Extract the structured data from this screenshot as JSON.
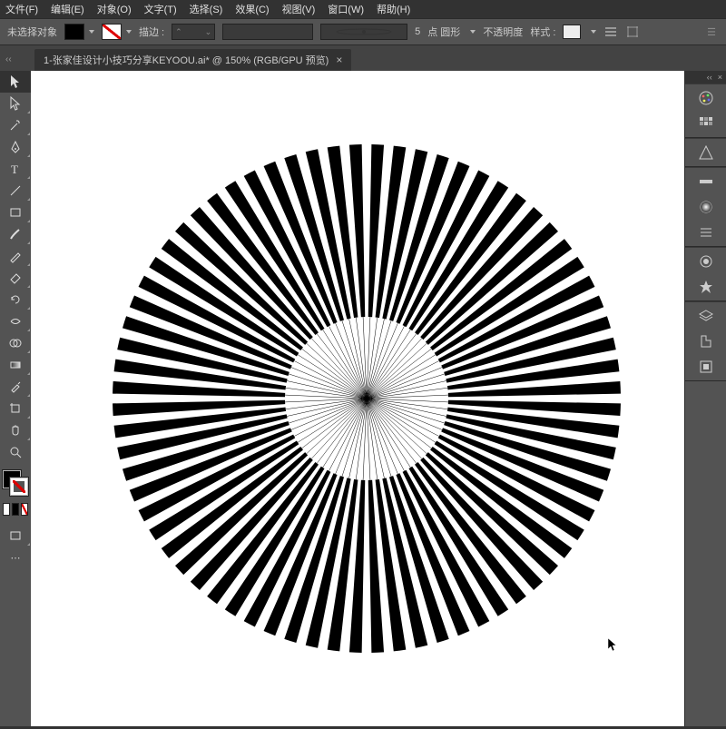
{
  "menu": {
    "items": [
      "文件(F)",
      "编辑(E)",
      "对象(O)",
      "文字(T)",
      "选择(S)",
      "效果(C)",
      "视图(V)",
      "窗口(W)",
      "帮助(H)"
    ]
  },
  "control_bar": {
    "selection_label": "未选择对象",
    "stroke_label": "描边 :",
    "stroke_value": "",
    "point_value": "5",
    "point_label": "点 圆形",
    "opacity_label": "不透明度",
    "style_label": "样式 :"
  },
  "tab": {
    "title": "1-张家佳设计小技巧分享KEYOOU.ai* @ 150% (RGB/GPU 预览)"
  },
  "tools": [
    "selection",
    "direct-selection",
    "magic-wand",
    "lasso",
    "pen",
    "curvature",
    "type",
    "line",
    "rectangle",
    "paintbrush",
    "pencil",
    "eraser",
    "rotate",
    "scale",
    "width",
    "free-transform",
    "shape-builder",
    "perspective",
    "mesh",
    "gradient",
    "eyedropper",
    "blend",
    "symbol-sprayer",
    "column-graph",
    "artboard",
    "slice",
    "hand",
    "zoom"
  ],
  "right_panels": [
    "color",
    "swatches",
    "color-guide",
    "stroke",
    "gradient",
    "transparency",
    "appearance",
    "graphic-styles",
    "layers",
    "assets",
    "artboards",
    "libraries"
  ]
}
